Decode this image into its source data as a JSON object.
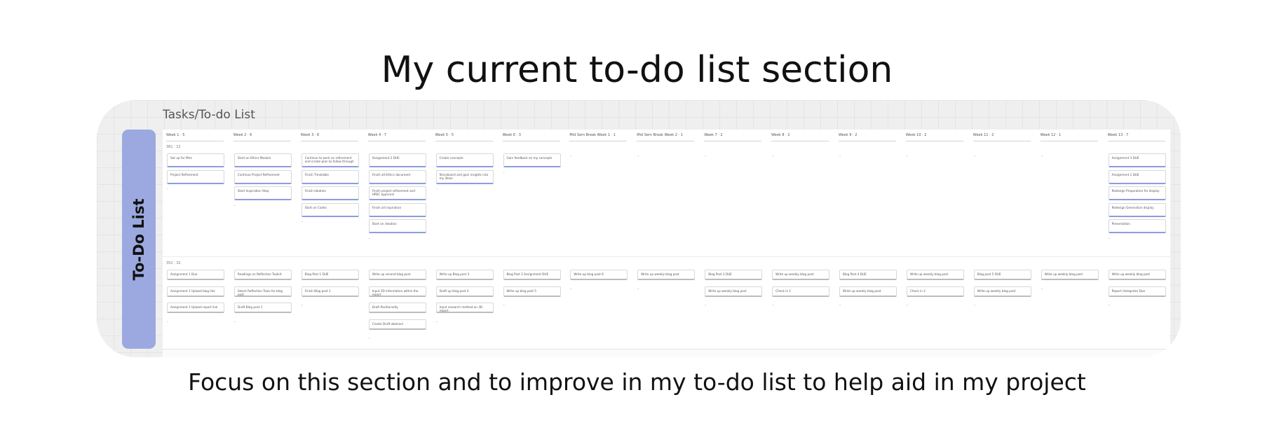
{
  "page": {
    "title": "My current to-do list section",
    "subtitle": "Focus on this section and to improve in my to-do list to help aid in my project"
  },
  "board": {
    "label": "Tasks/To-do List",
    "side_label": "To-Do List",
    "lane1_label": "381 · 22",
    "lane2_label": "352 · 32",
    "columns": [
      {
        "week": "Week 1 · 5",
        "lane1": [
          "Set up for Miro",
          "Project Refinement"
        ],
        "lane2": [
          "Assignment 1 Due",
          "Assignment 1 Upload blog link",
          "Assignment 1 Upload report link"
        ]
      },
      {
        "week": "Week 2 · 6",
        "lane1": [
          "Start on Ethics Module",
          "Continue Project Refinement",
          "Start Inspiration Step"
        ],
        "lane2": [
          "Readings on Reflection Toolkit",
          "Select Reflection Tools for blog post",
          "Draft Blog post 1"
        ]
      },
      {
        "week": "Week 3 · 6",
        "lane1": [
          "Continue to work on refinement and create plan to follow through",
          "Finish Timetable",
          "Finish ideation",
          "Start on Codes"
        ],
        "lane2": [
          "Blog Post 1 DUE",
          "Finish Blog post 1"
        ]
      },
      {
        "week": "Week 4 · 7",
        "lane1": [
          "Assignment 2 DUE",
          "Finish all Ethics document",
          "Finish project refinement and HREC approval",
          "Finish all inspiration",
          "Start on ideation"
        ],
        "lane2": [
          "Write up second blog post",
          "Input 3D information within the report",
          "Draft Positionality",
          "Create Draft abstract"
        ]
      },
      {
        "week": "Week 5 · 5",
        "lane1": [
          "Create concepts",
          "Storyboard and gain insights into my ideas"
        ],
        "lane2": [
          "Write up Blog post 3",
          "Draft up blog post 4",
          "Input research method on 3D report"
        ]
      },
      {
        "week": "Week 6 · 3",
        "lane1": [
          "Gain feedback on my concepts"
        ],
        "lane2": [
          "Blog Post 2 Assignment DUE",
          "Write up blog post 5"
        ]
      },
      {
        "week": "Mid Sem Break Week 1 · 1",
        "lane1": [],
        "lane2": [
          "Write up blog post 6"
        ]
      },
      {
        "week": "Mid Sem Break Week 2 · 1",
        "lane1": [],
        "lane2": [
          "Write up weekly blog post"
        ]
      },
      {
        "week": "Week 7 · 2",
        "lane1": [],
        "lane2": [
          "Blog Post 3 DUE",
          "Write up weekly blog post"
        ]
      },
      {
        "week": "Week 8 · 2",
        "lane1": [],
        "lane2": [
          "Write up weekly blog post",
          "Check in 1"
        ]
      },
      {
        "week": "Week 9 · 2",
        "lane1": [],
        "lane2": [
          "Blog Post 4 DUE",
          "Write up weekly blog post"
        ]
      },
      {
        "week": "Week 10 · 2",
        "lane1": [],
        "lane2": [
          "Write up weekly blog post",
          "Check in 2"
        ]
      },
      {
        "week": "Week 11 · 2",
        "lane1": [],
        "lane2": [
          "Blog post 5 DUE",
          "Write up weekly blog post"
        ]
      },
      {
        "week": "Week 12 · 1",
        "lane1": [],
        "lane2": [
          "Write up weekly blog post"
        ]
      },
      {
        "week": "Week 13 · 7",
        "lane1": [
          "Assignment 3 DUE",
          "Assignment 1 DUE",
          "Redesign Preparation for display",
          "Redesign Generation display",
          "Presentation"
        ],
        "lane2": [
          "Write up weekly blog post",
          "Report (Integrate) Due"
        ]
      }
    ]
  },
  "colors": {
    "accent": "#9ba9e0",
    "card_border": "#8d9ce0"
  }
}
